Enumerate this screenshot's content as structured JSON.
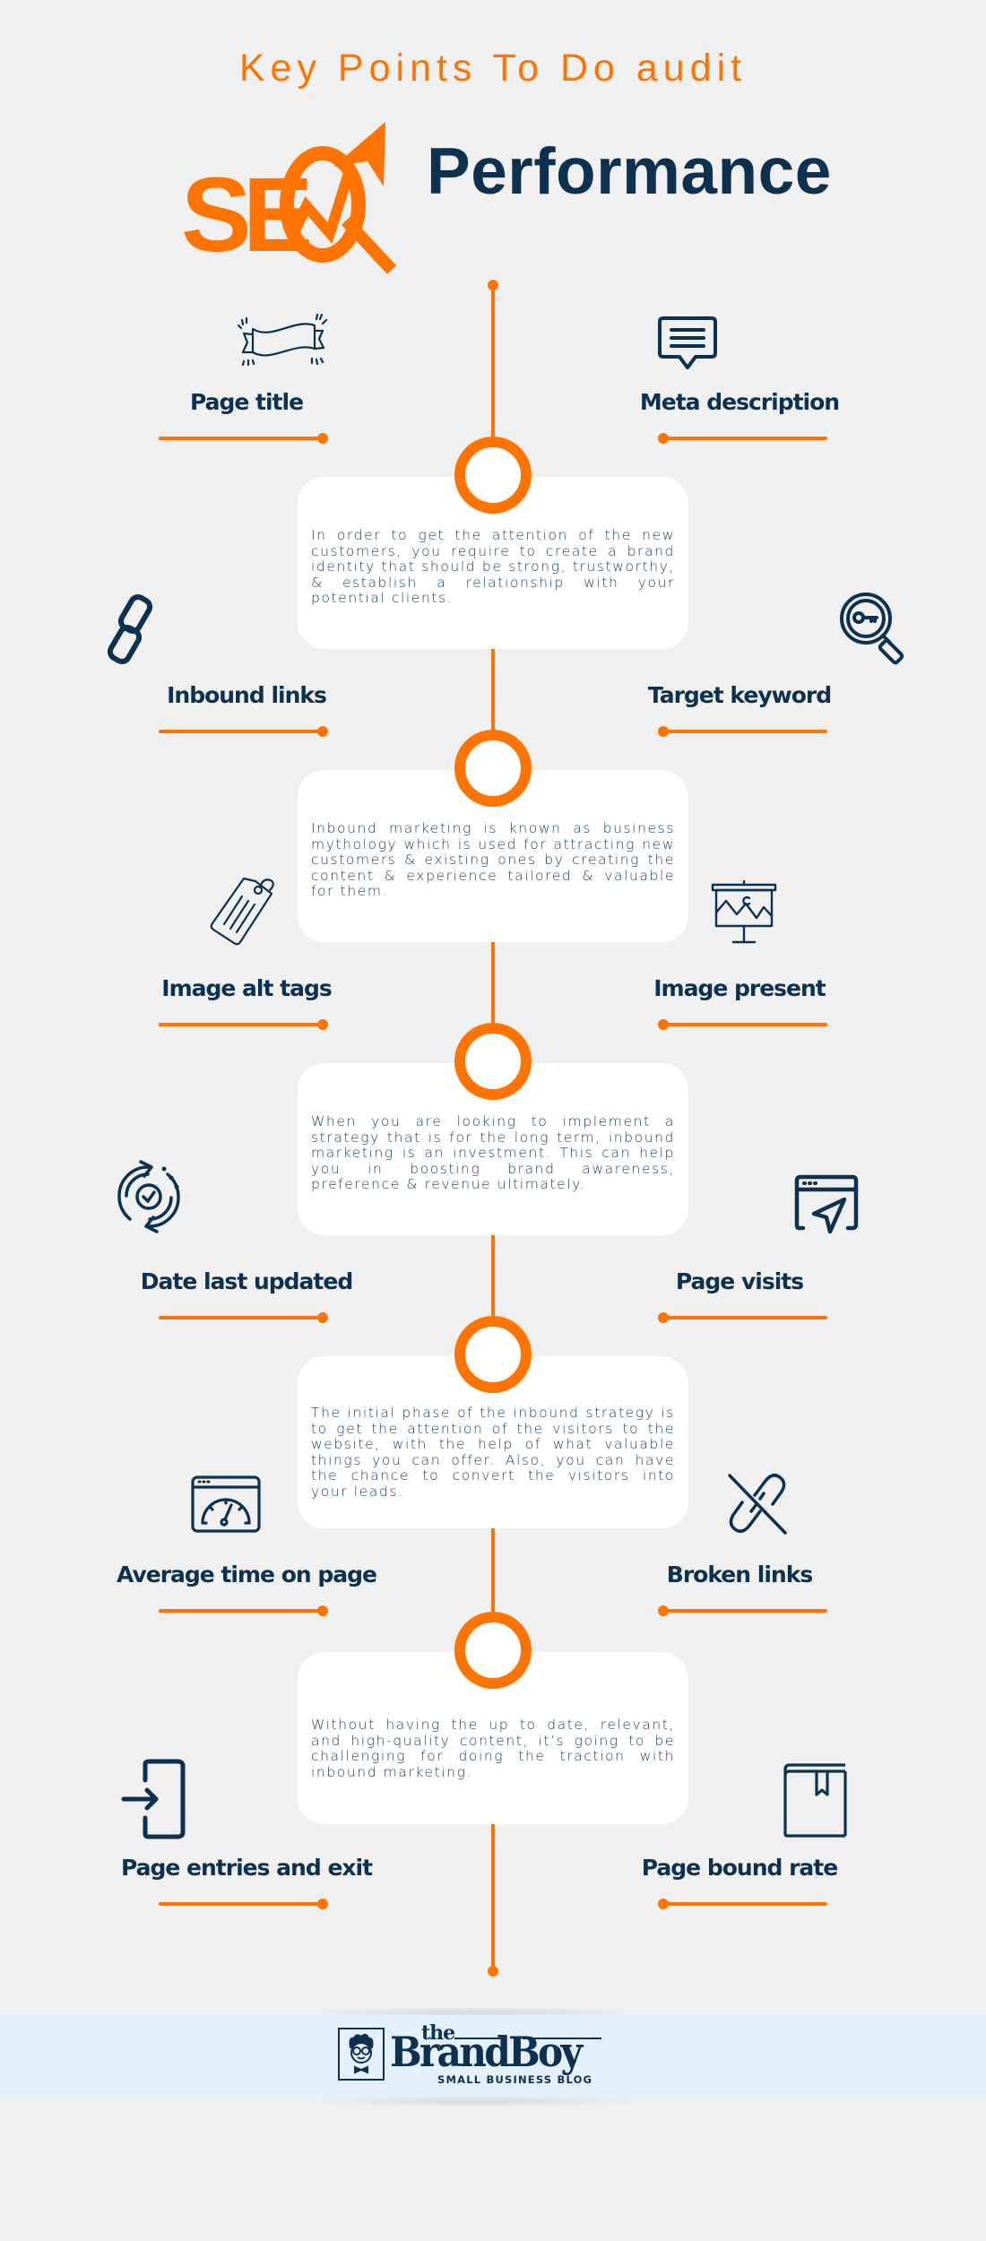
{
  "header": {
    "kicker": "Key Points To Do audit",
    "logo_word": "SEO",
    "title": "Performance"
  },
  "colors": {
    "background": "#F0F0F0",
    "navy": "#0E3150",
    "accent": "#FF7300",
    "card": "#FFFFFF",
    "footer_band": "#E4F0FC"
  },
  "sections": [
    {
      "left": {
        "label": "Page title",
        "icon": "ribbon-banner-icon"
      },
      "right": {
        "label": "Meta description",
        "icon": "speech-bubble-icon"
      }
    },
    {
      "card": "In order to get the attention of the new customers, you require to create a brand identity that should be strong, trustworthy, & establish a relationship with your potential clients.",
      "left": {
        "label": "Inbound links",
        "icon": "chain-link-icon"
      },
      "right": {
        "label": "Target keyword",
        "icon": "magnifier-key-icon"
      }
    },
    {
      "card": "Inbound marketing is known as business mythology which is used for attracting new customers & existing ones by creating the content & experience tailored & valuable for them.",
      "left": {
        "label": "Image alt tags",
        "icon": "price-tag-icon"
      },
      "right": {
        "label": "Image present",
        "icon": "presentation-board-icon"
      }
    },
    {
      "card": "When you are looking to implement a strategy that is for the long term, inbound marketing is an investment. This can help you in boosting brand awareness, preference & revenue ultimately.",
      "left": {
        "label": "Date last updated",
        "icon": "refresh-check-icon"
      },
      "right": {
        "label": "Page visits",
        "icon": "browser-cursor-icon"
      }
    },
    {
      "card": "The initial phase of the inbound strategy is to get the attention of the visitors to the website, with the help of what valuable things you can offer. Also, you can have the chance to convert the visitors into your leads.",
      "left": {
        "label": "Average time on page",
        "icon": "browser-gauge-icon"
      },
      "right": {
        "label": "Broken links",
        "icon": "broken-link-icon"
      }
    },
    {
      "card": "Without having the up to date, relevant, and high-quality content, it’s going to be challenging for doing the traction with inbound marketing.",
      "left": {
        "label": "Page entries and exit",
        "icon": "sign-in-door-icon"
      },
      "right": {
        "label": "Page bound rate",
        "icon": "bookmark-book-icon"
      }
    }
  ],
  "footer": {
    "logo_small": "the",
    "logo_main": "BrandBoy",
    "tagline": "SMALL BUSINESS BLOG"
  }
}
